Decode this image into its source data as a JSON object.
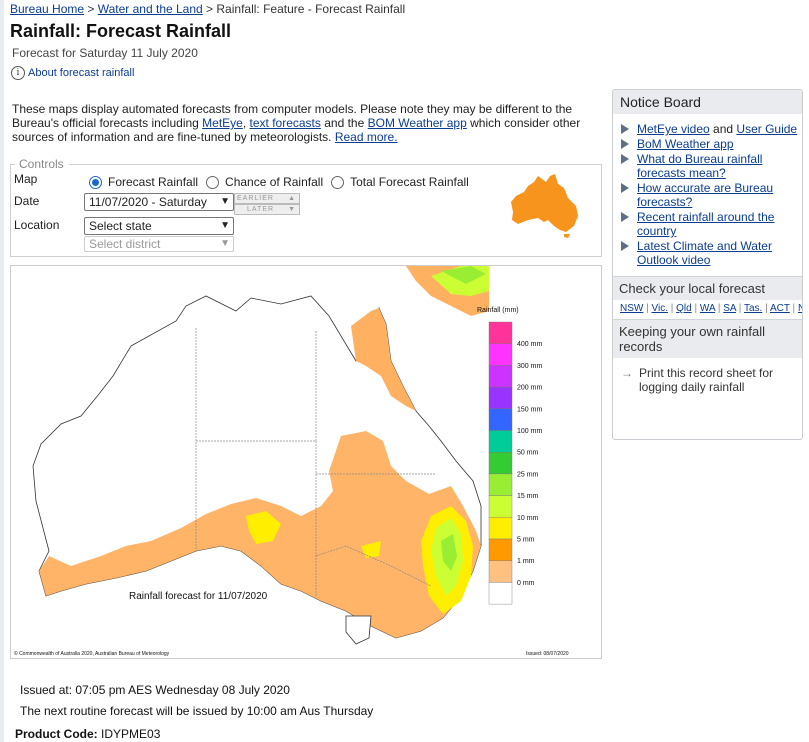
{
  "breadcrumb": [
    "Bureau Home",
    "Water and the Land",
    "Rainfall: Feature - Forecast Rainfall"
  ],
  "header": {
    "title": "Rainfall: Forecast Rainfall",
    "subtitle": "Forecast for Saturday 11 July 2020",
    "about_link": "About forecast rainfall",
    "about_icon": "info-icon"
  },
  "intro": {
    "text1": "These maps display automated forecasts from computer models. Please note they may be different to the Bureau's official forecasts including ",
    "link_meteye": "MetEye",
    "sep1": ", ",
    "link_text_forecasts": "text forecasts",
    "text2": " and the ",
    "link_bom_app": "BOM Weather app",
    "text3": " which consider other sources of information and are fine-tuned by meteorologists. ",
    "link_read_more": "Read more."
  },
  "controls": {
    "legend": "Controls",
    "map_label": "Map",
    "map_options": [
      "Forecast Rainfall",
      "Chance of Rainfall",
      "Total Forecast Rainfall"
    ],
    "map_selected": "Forecast Rainfall",
    "date_label": "Date",
    "date_value": "11/07/2020 - Saturday",
    "earlier_label": "EARLIER",
    "later_label": "LATER",
    "location_label": "Location",
    "state_value": "Select state",
    "district_value": "Select district"
  },
  "map": {
    "legend_title": "Rainfall (mm)",
    "legend_levels": [
      "400 mm",
      "300 mm",
      "200 mm",
      "150 mm",
      "100 mm",
      "50 mm",
      "25 mm",
      "15 mm",
      "10 mm",
      "5 mm",
      "1 mm",
      "0 mm"
    ],
    "legend_colors": [
      "#ff3399",
      "#ff33ff",
      "#cc33ff",
      "#9933ff",
      "#3366ff",
      "#00cc99",
      "#33cc33",
      "#99ee33",
      "#ccff33",
      "#ffee00",
      "#ff9900",
      "#ffc080",
      "#ffffff"
    ],
    "caption": "Rainfall forecast for 11/07/2020",
    "copyright": "© Commonwealth of Australia 2020, Australian Bureau of Meteorology",
    "issued": "Issued: 08/07/2020"
  },
  "notice": {
    "title": "Notice Board",
    "items": [
      {
        "link": "MetEye video",
        "mid": " and ",
        "link2": "User Guide"
      },
      {
        "link": "BoM Weather app",
        "mid": "",
        "link2": ""
      },
      {
        "link": "What do Bureau rainfall forecasts mean?",
        "mid": "",
        "link2": ""
      },
      {
        "link": "How accurate are Bureau forecasts?",
        "mid": "",
        "link2": ""
      },
      {
        "link": "Recent rainfall around the country",
        "mid": "",
        "link2": ""
      },
      {
        "link": "Latest Climate and Water Outlook video",
        "mid": "",
        "link2": ""
      }
    ],
    "local_title": "Check your local forecast",
    "local_links": [
      "NSW",
      "Vic.",
      "Qld",
      "WA",
      "SA",
      "Tas.",
      "ACT",
      "NT"
    ],
    "records_title": "Keeping your own rainfall records",
    "records_item": "Print this record sheet for logging daily rainfall"
  },
  "footer": {
    "issued": "Issued at: 07:05 pm AES Wednesday 08 July 2020",
    "next": "The next routine forecast will be issued by 10:00 am Aus Thursday",
    "product_label": "Product Code:",
    "product_code": "IDYPME03"
  }
}
